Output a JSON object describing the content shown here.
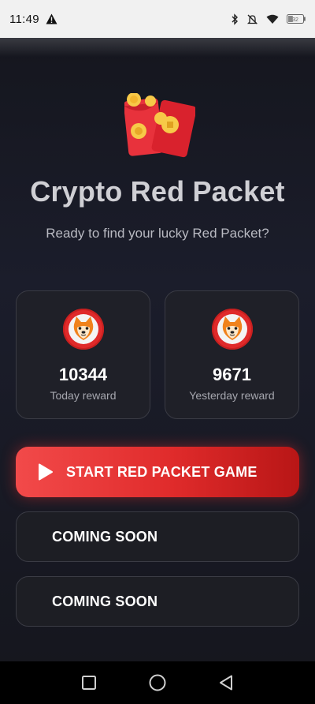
{
  "status_bar": {
    "time": "11:49",
    "icons": [
      "warning-icon",
      "bluetooth-icon",
      "mute-icon",
      "wifi-icon",
      "battery-icon"
    ],
    "battery_level": 0.32
  },
  "hero": {
    "icon": "red-packet-icon",
    "title": "Crypto Red Packet",
    "subtitle": "Ready to find your lucky Red Packet?"
  },
  "rewards": [
    {
      "icon": "shiba-coin-icon",
      "value": "10344",
      "label": "Today reward"
    },
    {
      "icon": "shiba-coin-icon",
      "value": "9671",
      "label": "Yesterday reward"
    }
  ],
  "buttons": {
    "start": {
      "icon": "play-icon",
      "label": "START RED PACKET GAME"
    },
    "coming_soon_1": {
      "label": "COMING SOON"
    },
    "coming_soon_2": {
      "label": "COMING SOON"
    }
  },
  "nav_bar": {
    "items": [
      "recents-icon",
      "home-icon",
      "back-icon"
    ]
  },
  "colors": {
    "accent": "#e53030",
    "background": "#181a24",
    "card": "#1f2028"
  }
}
